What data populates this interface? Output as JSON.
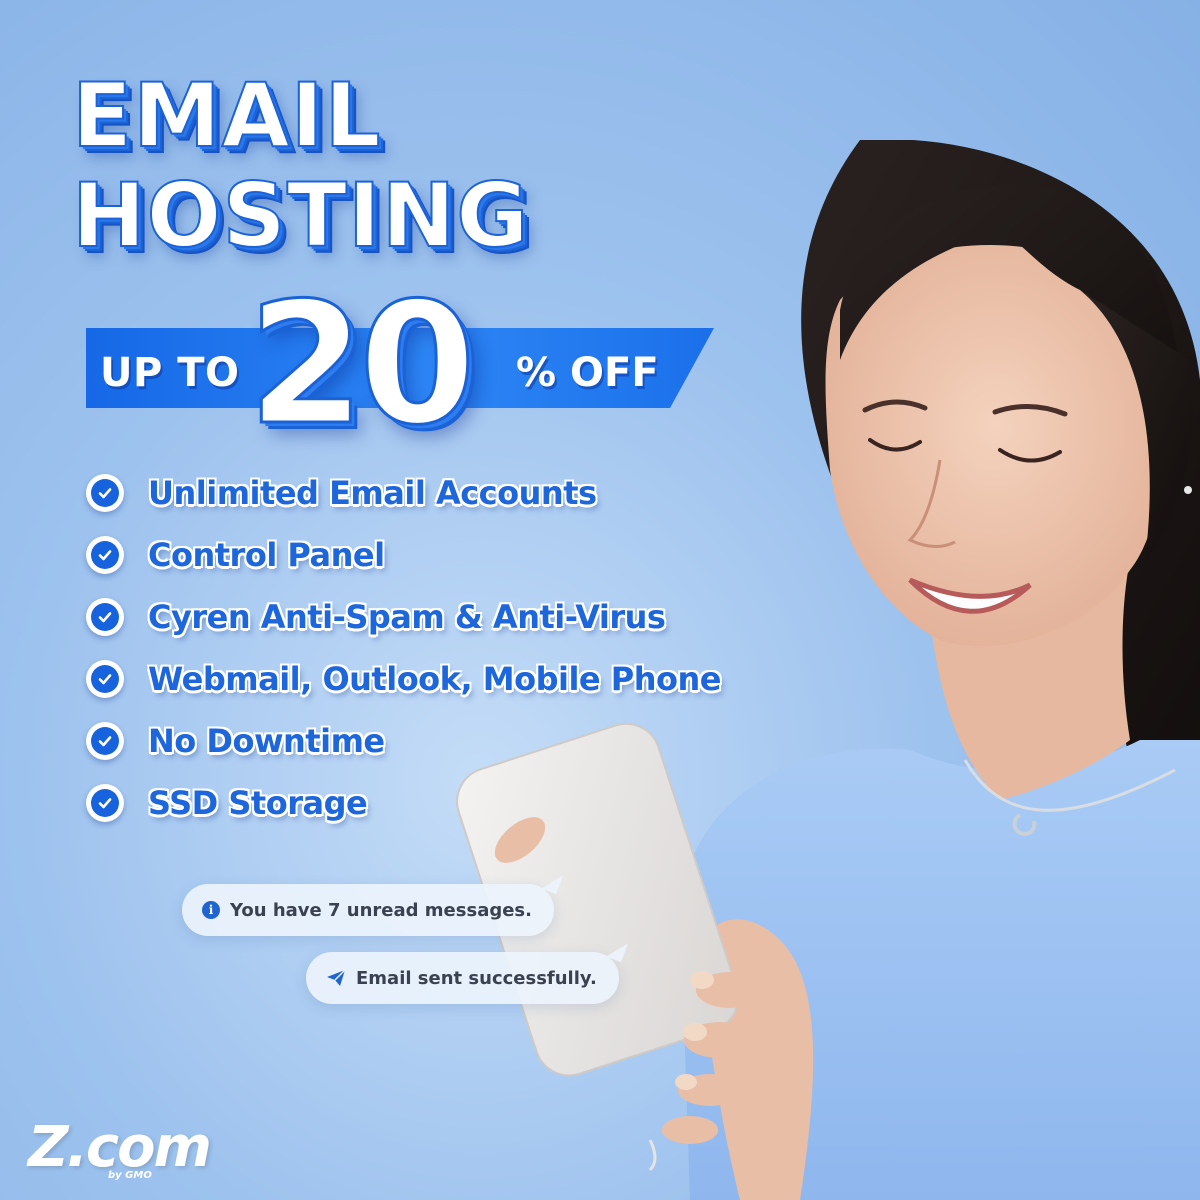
{
  "headline": {
    "line1": "EMAIL",
    "line2": "HOSTING"
  },
  "promo": {
    "prefix": "UP TO",
    "number": "20",
    "suffix": "% OFF"
  },
  "features": [
    "Unlimited Email Accounts",
    "Control Panel",
    "Cyren Anti-Spam & Anti-Virus",
    "Webmail, Outlook, Mobile Phone",
    "No Downtime",
    "SSD Storage"
  ],
  "notifications": {
    "unread": {
      "icon": "info-icon",
      "text": "You have 7 unread messages."
    },
    "sent": {
      "icon": "paper-plane-icon",
      "text": "Email sent successfully."
    }
  },
  "logo": {
    "brand": "Z.com",
    "byline": "by GMO"
  },
  "colors": {
    "background": "#9dc2ee",
    "accent": "#1763de",
    "headline_fill": "#ffffff",
    "shirt": "#9fc3f2"
  }
}
